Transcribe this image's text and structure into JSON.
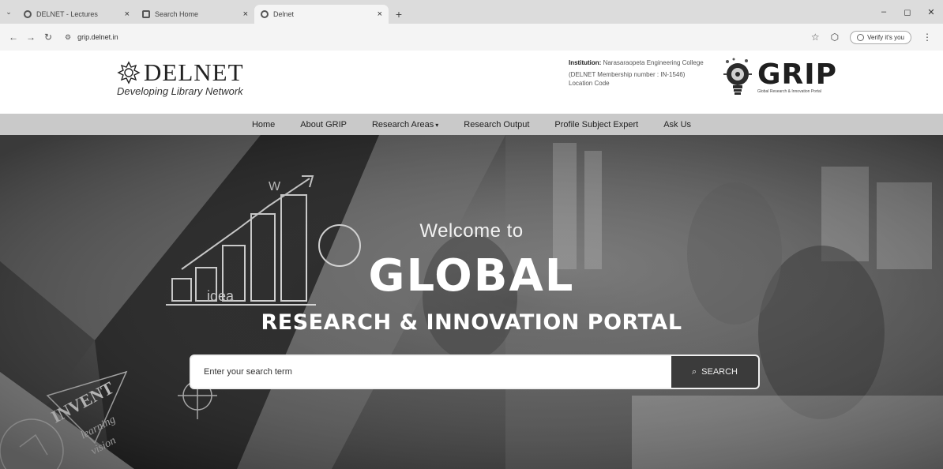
{
  "browser": {
    "tabs": [
      {
        "title": "DELNET - Lectures",
        "active": false
      },
      {
        "title": "Search Home",
        "active": false
      },
      {
        "title": "Delnet",
        "active": true
      }
    ],
    "url": "grip.delnet.in",
    "verify_label": "Verify it's you"
  },
  "header": {
    "delnet_name": "DELNET",
    "delnet_tagline": "Developing Library Network",
    "institution_label": "Institution:",
    "institution_value": "Narasaraopeta Engineering College",
    "membership_text": "(DELNET Membership number : IN-1546)",
    "location_code": "Location Code",
    "grip_word": "GRIP",
    "grip_subtitle": "Global Research & Innovation Portal"
  },
  "nav": {
    "items": [
      {
        "label": "Home"
      },
      {
        "label": "About GRIP"
      },
      {
        "label": "Research Areas"
      },
      {
        "label": "Research Output"
      },
      {
        "label": "Profile Subject Expert"
      },
      {
        "label": "Ask Us"
      }
    ]
  },
  "hero": {
    "welcome": "Welcome to",
    "title": "GLOBAL",
    "subtitle": "RESEARCH & INNOVATION PORTAL",
    "search_placeholder": "Enter your search term",
    "search_button": "SEARCH",
    "decor_words": [
      "INVENT",
      "learning",
      "vision",
      "idea",
      "W"
    ]
  },
  "colors": {
    "nav_bg": "#c9c9c9",
    "search_button_bg": "#3b3b3b",
    "hero_text": "#ffffff"
  }
}
